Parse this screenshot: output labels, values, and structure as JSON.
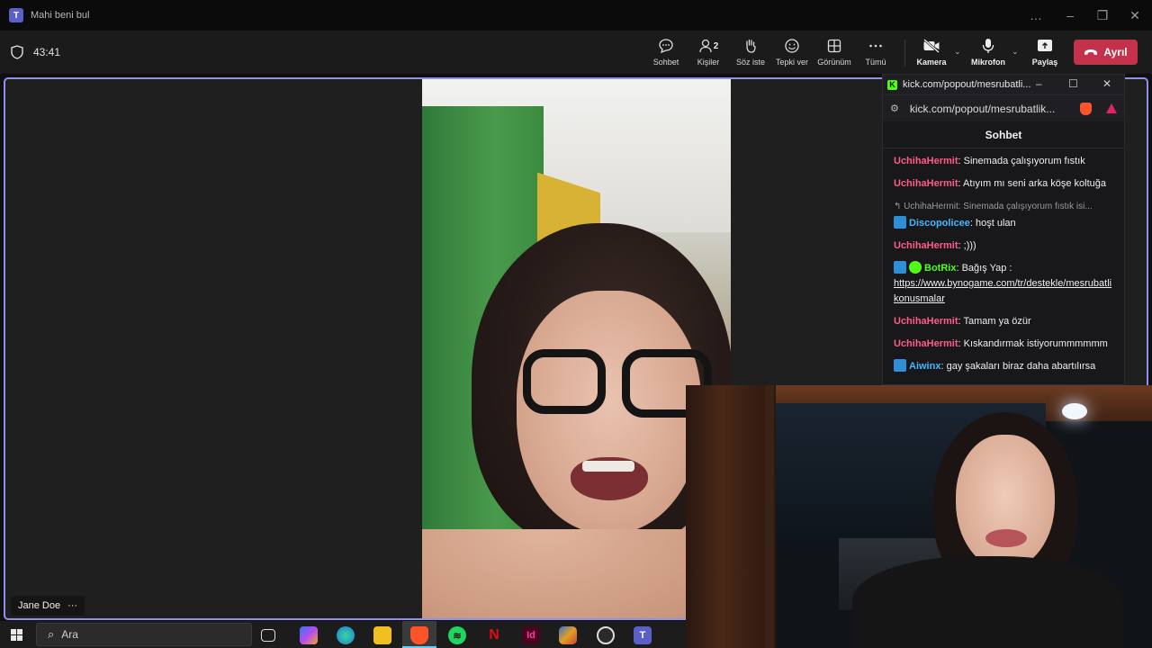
{
  "window": {
    "title": "Mahi beni bul",
    "controls": [
      "…",
      "–",
      "❐",
      "✕"
    ]
  },
  "toolbar": {
    "timer": "43:41",
    "buttons": [
      {
        "label": "Sohbet",
        "icon": "chat-icon"
      },
      {
        "label": "Kişiler",
        "icon": "people-icon",
        "count": "2"
      },
      {
        "label": "Söz iste",
        "icon": "raise-hand-icon"
      },
      {
        "label": "Tepki ver",
        "icon": "react-icon"
      },
      {
        "label": "Görünüm",
        "icon": "view-icon"
      },
      {
        "label": "Tümü",
        "icon": "more-icon"
      }
    ],
    "camera_label": "Kamera",
    "mic_label": "Mikrofon",
    "share_label": "Paylaş",
    "leave_label": "Ayrıl",
    "leave_color": "#c4314b",
    "accent_color": "#8e8ff0"
  },
  "participant": {
    "name": "Jane Doe",
    "more": "···"
  },
  "kick": {
    "window_title": "kick.com/popout/mesrubatli...",
    "url": "kick.com/popout/mesrubatlik...",
    "header": "Sohbet",
    "messages": [
      {
        "user": "UchihaHermit",
        "color": "#ff5c8a",
        "text": "Sinemada çalışıyorum fıstık"
      },
      {
        "user": "UchihaHermit",
        "color": "#ff5c8a",
        "text": "Atıyım mı seni arka köşe koltuğa"
      },
      {
        "reply": "UchihaHermit: Sinemada çalışıyorum fıstık isi...",
        "user": "Discopolicee",
        "color": "#41b8ff",
        "text": "hoşt ulan",
        "badge": "bot"
      },
      {
        "user": "UchihaHermit",
        "color": "#ff5c8a",
        "text": ";)))"
      },
      {
        "user": "BotRix",
        "color": "#53fc18",
        "text": "Bağış Yap :",
        "link": "https://www.bynogame.com/tr/destekle/mesrubatlikonusmalar",
        "badge": "bot-verified"
      },
      {
        "user": "UchihaHermit",
        "color": "#ff5c8a",
        "text": "Tamam ya özür"
      },
      {
        "user": "UchihaHermit",
        "color": "#ff5c8a",
        "text": "Kıskandırmak istiyorummmmmm"
      },
      {
        "user": "Aiwinx",
        "color": "#41b8ff",
        "text": "gay şakaları biraz daha abartılırsa",
        "badge": "bot"
      }
    ]
  },
  "taskbar": {
    "search_placeholder": "Ara",
    "apps": [
      "task-view",
      "copilot",
      "edge",
      "file-explorer",
      "brave",
      "spotify",
      "netflix",
      "indesign",
      "davinci-resolve",
      "obs",
      "teams"
    ]
  }
}
